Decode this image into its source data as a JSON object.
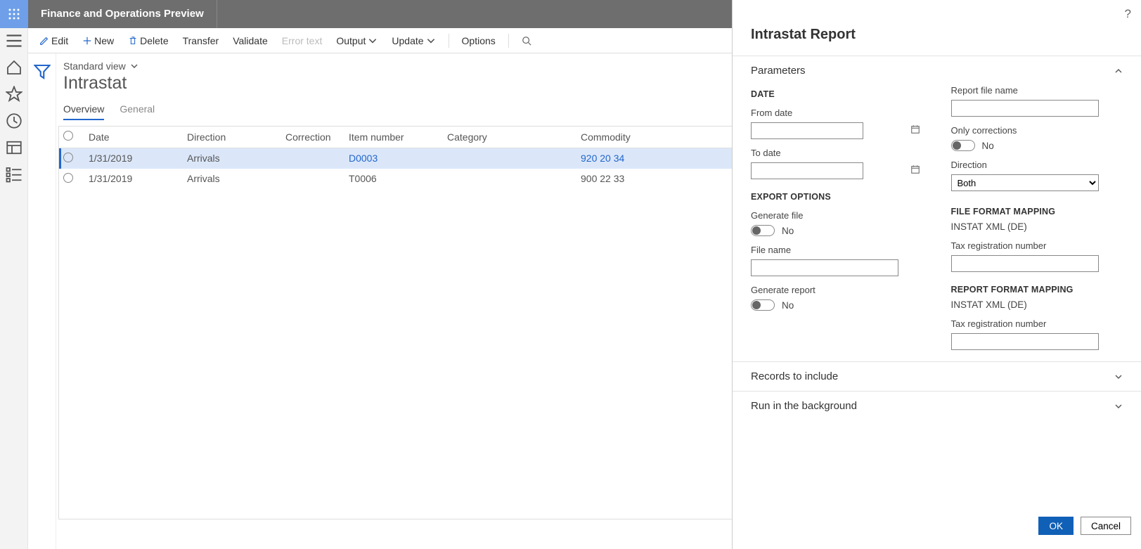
{
  "app": {
    "title": "Finance and Operations Preview"
  },
  "actions": {
    "edit": "Edit",
    "new": "New",
    "delete": "Delete",
    "transfer": "Transfer",
    "validate": "Validate",
    "error_text": "Error text",
    "output": "Output",
    "update": "Update",
    "options": "Options"
  },
  "view": {
    "name": "Standard view"
  },
  "page": {
    "title": "Intrastat"
  },
  "tabs": {
    "overview": "Overview",
    "general": "General"
  },
  "grid": {
    "headers": {
      "date": "Date",
      "direction": "Direction",
      "correction": "Correction",
      "item": "Item number",
      "category": "Category",
      "commodity": "Commodity"
    },
    "rows": [
      {
        "date": "1/31/2019",
        "direction": "Arrivals",
        "correction": "",
        "item": "D0003",
        "category": "",
        "commodity": "920 20 34",
        "selected": true
      },
      {
        "date": "1/31/2019",
        "direction": "Arrivals",
        "correction": "",
        "item": "T0006",
        "category": "",
        "commodity": "900 22 33",
        "selected": false
      }
    ]
  },
  "panel": {
    "title": "Intrastat Report",
    "parameters_label": "Parameters",
    "records_label": "Records to include",
    "background_label": "Run in the background",
    "date_heading": "DATE",
    "from_date_label": "From date",
    "from_date": "",
    "to_date_label": "To date",
    "to_date": "",
    "export_heading": "EXPORT OPTIONS",
    "gen_file_label": "Generate file",
    "gen_file_state": "No",
    "file_name_label": "File name",
    "file_name": "",
    "gen_report_label": "Generate report",
    "gen_report_state": "No",
    "report_file_label": "Report file name",
    "report_file": "",
    "only_corr_label": "Only corrections",
    "only_corr_state": "No",
    "direction_label": "Direction",
    "direction_value": "Both",
    "file_format_heading": "FILE FORMAT MAPPING",
    "file_format_value": "INSTAT XML (DE)",
    "tax_reg_label": "Tax registration number",
    "tax_reg": "",
    "report_format_heading": "REPORT FORMAT MAPPING",
    "report_format_value": "INSTAT XML (DE)",
    "tax_reg2_label": "Tax registration number",
    "tax_reg2": "",
    "ok": "OK",
    "cancel": "Cancel"
  }
}
